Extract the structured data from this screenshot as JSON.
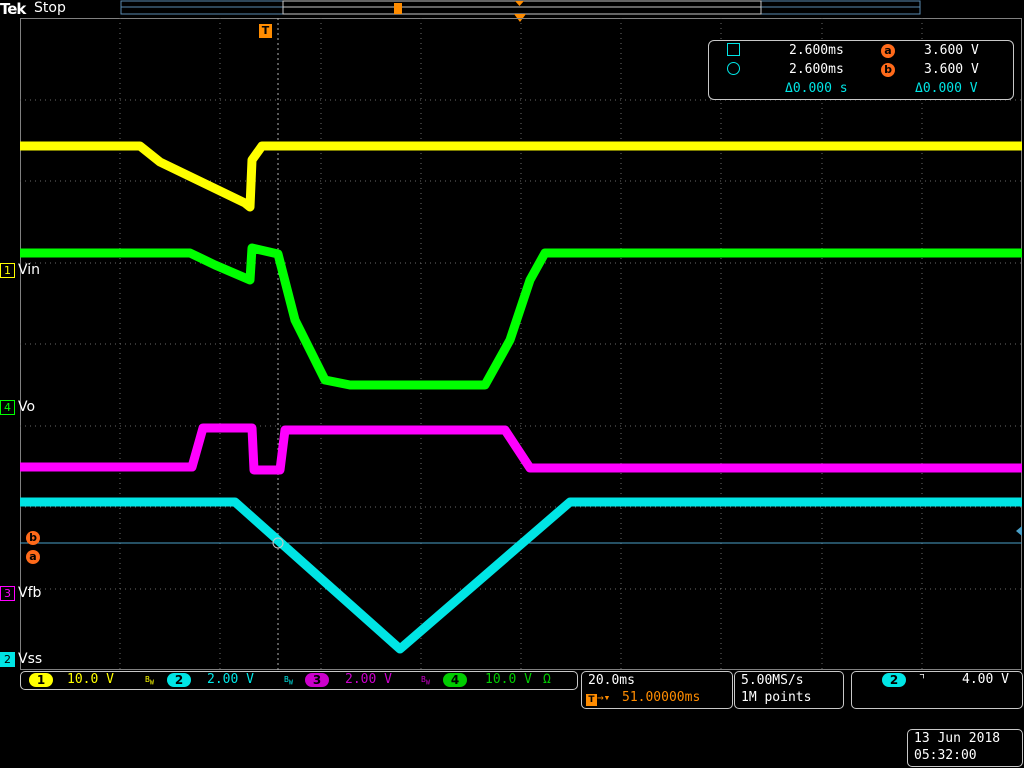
{
  "header": {
    "brand": "Tek",
    "run_state": "Stop"
  },
  "trigger_marker": "T",
  "cursors": {
    "square_time": "2.600ms",
    "circle_time": "2.600ms",
    "a_label": "a",
    "a_value": "3.600 V",
    "b_label": "b",
    "b_value": "3.600 V",
    "delta_time": "Δ0.000 s",
    "delta_volt": "Δ0.000 V"
  },
  "channel_labels": [
    {
      "num": "1",
      "name": "Vin",
      "color": "#ffff00"
    },
    {
      "num": "4",
      "name": "Vo",
      "color": "#00ff00"
    },
    {
      "num": "3",
      "name": "Vfb",
      "color": "#ff00ff"
    },
    {
      "num": "2",
      "name": "Vss",
      "color": "#00e5e5"
    }
  ],
  "ref_markers": {
    "b": "b",
    "a": "a"
  },
  "channel_settings": [
    {
      "num": "1",
      "scale": "10.0 V",
      "color": "#ffff00",
      "suffix": ""
    },
    {
      "num": "2",
      "scale": "2.00 V",
      "color": "#00e5e5",
      "suffix": ""
    },
    {
      "num": "3",
      "scale": "2.00 V",
      "color": "#cc00cc",
      "suffix": ""
    },
    {
      "num": "4",
      "scale": "10.0 V",
      "color": "#00cc00",
      "suffix": "Ω"
    }
  ],
  "timebase": {
    "scale": "20.0ms",
    "trigger_pos": "51.00000ms"
  },
  "acquisition": {
    "rate": "5.00MS/s",
    "points": "1M points"
  },
  "trigger": {
    "source": "2",
    "level": "4.00 V"
  },
  "datetime": {
    "date": "13 Jun 2018",
    "time": "05:32:00"
  }
}
